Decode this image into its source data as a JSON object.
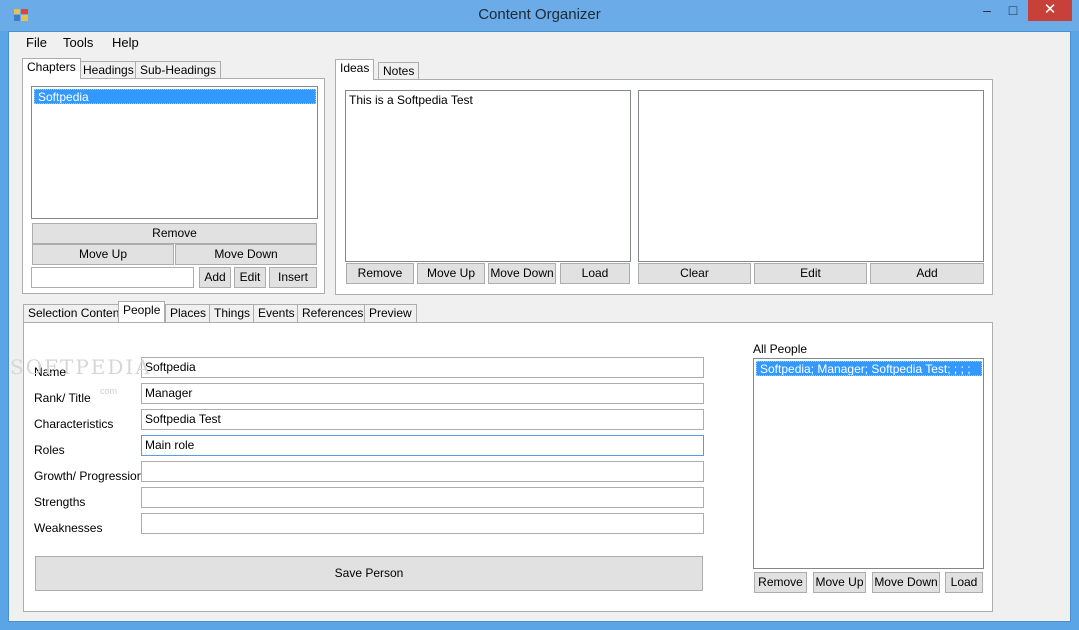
{
  "window": {
    "title": "Content Organizer",
    "minimize_glyph": "–",
    "maximize_glyph": "□",
    "close_glyph": "✕"
  },
  "menu": [
    "File",
    "Tools",
    "Help"
  ],
  "structure_tabs": [
    "Chapters",
    "Headings",
    "Sub-Headings"
  ],
  "structure_tab_active": "Chapters",
  "chapters": {
    "items": [
      "Softpedia"
    ],
    "selected_item": "Softpedia",
    "input_value": "",
    "remove_label": "Remove",
    "move_up_label": "Move Up",
    "move_down_label": "Move Down",
    "add_label": "Add",
    "edit_label": "Edit",
    "insert_label": "Insert"
  },
  "ideas_tabs": [
    "Ideas",
    "Notes"
  ],
  "ideas_tab_active": "Ideas",
  "ideas": {
    "text": "This is a Softpedia Test",
    "remove_label": "Remove",
    "move_up_label": "Move Up",
    "move_down_label": "Move Down",
    "load_label": "Load",
    "detail_text": "",
    "clear_label": "Clear",
    "edit_label": "Edit",
    "add_label": "Add"
  },
  "content_tabs": [
    "Selection Content",
    "People",
    "Places",
    "Things",
    "Events",
    "References",
    "Preview"
  ],
  "content_tab_active": "People",
  "people_form": {
    "fields": [
      {
        "label": "Name",
        "value": "Softpedia"
      },
      {
        "label": "Rank/ Title",
        "value": "Manager"
      },
      {
        "label": "Characteristics",
        "value": "Softpedia Test"
      },
      {
        "label": "Roles",
        "value": "Main role"
      },
      {
        "label": "Growth/ Progression",
        "value": ""
      },
      {
        "label": "Strengths",
        "value": ""
      },
      {
        "label": "Weaknesses",
        "value": ""
      }
    ],
    "save_label": "Save Person"
  },
  "all_people": {
    "heading": "All People",
    "items": [
      "Softpedia; Manager; Softpedia Test; ; ; ;"
    ],
    "remove_label": "Remove",
    "move_up_label": "Move Up",
    "move_down_label": "Move Down",
    "load_label": "Load"
  },
  "watermark": {
    "text": "SOFTPEDIA",
    "small_text": "com"
  },
  "colors": {
    "title_bar": "#6aabe8",
    "close_button": "#c7413a",
    "selection": "#3399ff",
    "window_bg": "#f0f0f0"
  }
}
